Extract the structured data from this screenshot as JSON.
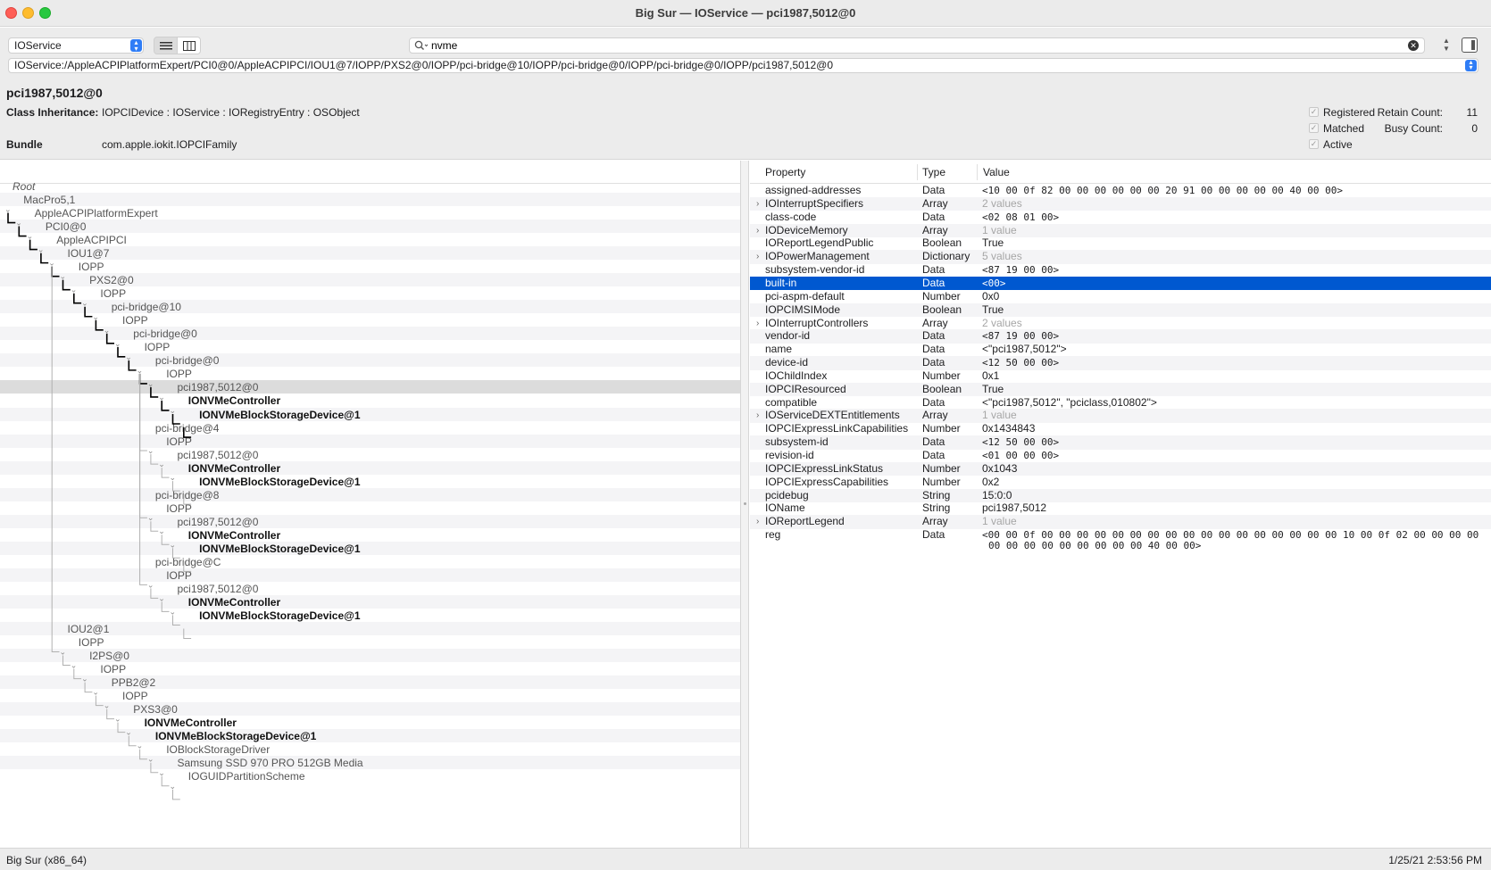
{
  "window": {
    "title": "Big Sur — IOService — pci1987,5012@0"
  },
  "toolbar": {
    "plane": "IOService",
    "search_value": "nvme",
    "path": "IOService:/AppleACPIPlatformExpert/PCI0@0/AppleACPIPCI/IOU1@7/IOPP/PXS2@0/IOPP/pci-bridge@10/IOPP/pci-bridge@0/IOPP/pci-bridge@0/IOPP/pci1987,5012@0"
  },
  "info": {
    "node_title": "pci1987,5012@0",
    "class_label": "Class Inheritance:",
    "class_value": "IOPCIDevice : IOService : IORegistryEntry : OSObject",
    "bundle_label": "Bundle",
    "bundle_value": "com.apple.iokit.IOPCIFamily",
    "registered": "Registered",
    "matched": "Matched",
    "active": "Active",
    "retain_label": "Retain Count:",
    "retain_value": "11",
    "busy_label": "Busy Count:",
    "busy_value": "0"
  },
  "tree": [
    {
      "label": "Root",
      "depth": 0,
      "style": "italic"
    },
    {
      "label": "MacPro5,1",
      "depth": 1
    },
    {
      "label": "AppleACPIPlatformExpert",
      "depth": 2
    },
    {
      "label": "PCI0@0",
      "depth": 3
    },
    {
      "label": "AppleACPIPCI",
      "depth": 4
    },
    {
      "label": "IOU1@7",
      "depth": 5
    },
    {
      "label": "IOPP",
      "depth": 6
    },
    {
      "label": "PXS2@0",
      "depth": 7
    },
    {
      "label": "IOPP",
      "depth": 8
    },
    {
      "label": "pci-bridge@10",
      "depth": 9
    },
    {
      "label": "IOPP",
      "depth": 10
    },
    {
      "label": "pci-bridge@0",
      "depth": 11
    },
    {
      "label": "IOPP",
      "depth": 12
    },
    {
      "label": "pci-bridge@0",
      "depth": 13
    },
    {
      "label": "IOPP",
      "depth": 14
    },
    {
      "label": "pci1987,5012@0",
      "depth": 15,
      "selected": true
    },
    {
      "label": "IONVMeController",
      "depth": 16,
      "style": "bold"
    },
    {
      "label": "IONVMeBlockStorageDevice@1",
      "depth": 17,
      "style": "bold"
    },
    {
      "label": "pci-bridge@4",
      "depth": 13
    },
    {
      "label": "IOPP",
      "depth": 14
    },
    {
      "label": "pci1987,5012@0",
      "depth": 15
    },
    {
      "label": "IONVMeController",
      "depth": 16,
      "style": "bold"
    },
    {
      "label": "IONVMeBlockStorageDevice@1",
      "depth": 17,
      "style": "bold"
    },
    {
      "label": "pci-bridge@8",
      "depth": 13
    },
    {
      "label": "IOPP",
      "depth": 14
    },
    {
      "label": "pci1987,5012@0",
      "depth": 15
    },
    {
      "label": "IONVMeController",
      "depth": 16,
      "style": "bold"
    },
    {
      "label": "IONVMeBlockStorageDevice@1",
      "depth": 17,
      "style": "bold"
    },
    {
      "label": "pci-bridge@C",
      "depth": 13
    },
    {
      "label": "IOPP",
      "depth": 14
    },
    {
      "label": "pci1987,5012@0",
      "depth": 15
    },
    {
      "label": "IONVMeController",
      "depth": 16,
      "style": "bold"
    },
    {
      "label": "IONVMeBlockStorageDevice@1",
      "depth": 17,
      "style": "bold"
    },
    {
      "label": "IOU2@1",
      "depth": 5
    },
    {
      "label": "IOPP",
      "depth": 6
    },
    {
      "label": "I2PS@0",
      "depth": 7
    },
    {
      "label": "IOPP",
      "depth": 8
    },
    {
      "label": "PPB2@2",
      "depth": 9
    },
    {
      "label": "IOPP",
      "depth": 10
    },
    {
      "label": "PXS3@0",
      "depth": 11
    },
    {
      "label": "IONVMeController",
      "depth": 12,
      "style": "bold"
    },
    {
      "label": "IONVMeBlockStorageDevice@1",
      "depth": 13,
      "style": "bold"
    },
    {
      "label": "IOBlockStorageDriver",
      "depth": 14
    },
    {
      "label": "Samsung SSD 970 PRO 512GB Media",
      "depth": 15
    },
    {
      "label": "IOGUIDPartitionScheme",
      "depth": 16
    }
  ],
  "properties": {
    "headers": {
      "property": "Property",
      "type": "Type",
      "value": "Value"
    },
    "rows": [
      {
        "name": "assigned-addresses",
        "type": "Data",
        "value": "<10 00 0f 82 00 00 00 00 00 00 20 91 00 00 00 00 00 40 00 00>"
      },
      {
        "name": "IOInterruptSpecifiers",
        "type": "Array",
        "value": "2 values",
        "expand": true
      },
      {
        "name": "class-code",
        "type": "Data",
        "value": "<02 08 01 00>"
      },
      {
        "name": "IODeviceMemory",
        "type": "Array",
        "value": "1 value",
        "expand": true
      },
      {
        "name": "IOReportLegendPublic",
        "type": "Boolean",
        "value": "True",
        "plain": true
      },
      {
        "name": "IOPowerManagement",
        "type": "Dictionary",
        "value": "5 values",
        "expand": true
      },
      {
        "name": "subsystem-vendor-id",
        "type": "Data",
        "value": "<87 19 00 00>"
      },
      {
        "name": "built-in",
        "type": "Data",
        "value": "<00>",
        "selected": true
      },
      {
        "name": "pci-aspm-default",
        "type": "Number",
        "value": "0x0",
        "plain": true
      },
      {
        "name": "IOPCIMSIMode",
        "type": "Boolean",
        "value": "True",
        "plain": true
      },
      {
        "name": "IOInterruptControllers",
        "type": "Array",
        "value": "2 values",
        "expand": true
      },
      {
        "name": "vendor-id",
        "type": "Data",
        "value": "<87 19 00 00>"
      },
      {
        "name": "name",
        "type": "Data",
        "value": "<\"pci1987,5012\">",
        "plain": true
      },
      {
        "name": "device-id",
        "type": "Data",
        "value": "<12 50 00 00>"
      },
      {
        "name": "IOChildIndex",
        "type": "Number",
        "value": "0x1",
        "plain": true
      },
      {
        "name": "IOPCIResourced",
        "type": "Boolean",
        "value": "True",
        "plain": true
      },
      {
        "name": "compatible",
        "type": "Data",
        "value": "<\"pci1987,5012\", \"pciclass,010802\">",
        "plain": true
      },
      {
        "name": "IOServiceDEXTEntitlements",
        "type": "Array",
        "value": "1 value",
        "expand": true
      },
      {
        "name": "IOPCIExpressLinkCapabilities",
        "type": "Number",
        "value": "0x1434843",
        "plain": true
      },
      {
        "name": "subsystem-id",
        "type": "Data",
        "value": "<12 50 00 00>"
      },
      {
        "name": "revision-id",
        "type": "Data",
        "value": "<01 00 00 00>"
      },
      {
        "name": "IOPCIExpressLinkStatus",
        "type": "Number",
        "value": "0x1043",
        "plain": true
      },
      {
        "name": "IOPCIExpressCapabilities",
        "type": "Number",
        "value": "0x2",
        "plain": true
      },
      {
        "name": "pcidebug",
        "type": "String",
        "value": "15:0:0",
        "plain": true
      },
      {
        "name": "IOName",
        "type": "String",
        "value": "pci1987,5012",
        "plain": true
      },
      {
        "name": "IOReportLegend",
        "type": "Array",
        "value": "1 value",
        "expand": true
      },
      {
        "name": "reg",
        "type": "Data",
        "value": "<00 00 0f 00 00 00 00 00 00 00 00 00 00 00 00 00 00 00 00 00 10 00 0f 02 00 00 00 00",
        "value2": "00 00 00 00 00 00 00 00 00 40 00 00>"
      }
    ]
  },
  "status": {
    "left": "Big Sur (x86_64)",
    "right": "1/25/21 2:53:56 PM"
  },
  "colors": {
    "selection": "#0058d0",
    "tree_selection": "#dcdcdc",
    "stepper": "#2f7df6"
  }
}
